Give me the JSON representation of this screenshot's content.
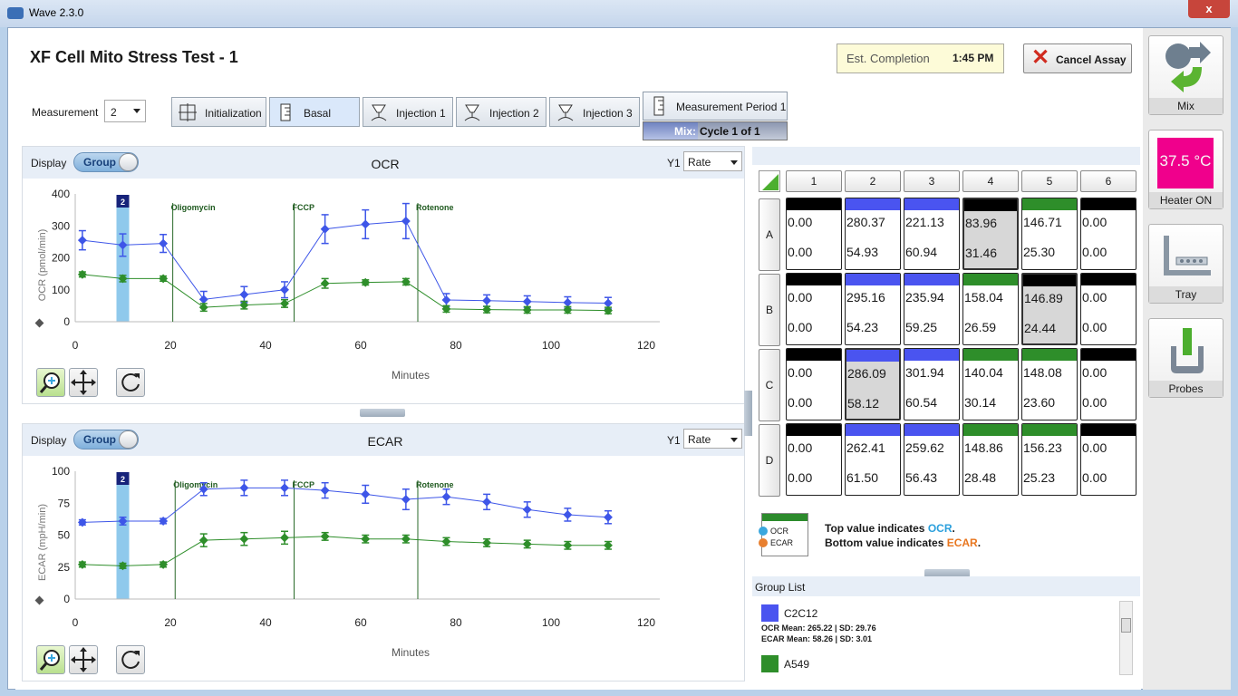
{
  "window": {
    "title": "Wave 2.3.0",
    "close_label": "x"
  },
  "header": {
    "title": "XF Cell Mito Stress Test - 1",
    "est_label": "Est. Completion",
    "est_value": "1:45 PM",
    "cancel_label": "Cancel Assay"
  },
  "measurement": {
    "label": "Measurement",
    "value": "2"
  },
  "steps": [
    "Initialization",
    "Basal",
    "Injection 1",
    "Injection 2",
    "Injection 3"
  ],
  "period": {
    "label": "Measurement Period 1",
    "mix_label": "Mix:",
    "cycle_label": "Cycle 1 of 1"
  },
  "display_label": "Display",
  "toggle_label": "Group",
  "y1_label": "Y1",
  "y1_value": "Rate",
  "ocr": {
    "title": "OCR",
    "ylabel": "OCR (pmol/min)",
    "xlabel": "Minutes"
  },
  "ecar": {
    "title": "ECAR",
    "ylabel": "ECAR (mpH/min)",
    "xlabel": "Minutes"
  },
  "plate": {
    "cols": [
      "1",
      "2",
      "3",
      "4",
      "5",
      "6"
    ],
    "rows": [
      "A",
      "B",
      "C",
      "D"
    ],
    "wells": [
      [
        {
          "o": "0.00",
          "e": "0.00",
          "c": "#000000"
        },
        {
          "o": "280.37",
          "e": "54.93",
          "c": "#4a54f0"
        },
        {
          "o": "221.13",
          "e": "60.94",
          "c": "#4a54f0"
        },
        {
          "o": "83.96",
          "e": "31.46",
          "c": "#000000",
          "s": 1
        },
        {
          "o": "146.71",
          "e": "25.30",
          "c": "#2e8e2a"
        },
        {
          "o": "0.00",
          "e": "0.00",
          "c": "#000000"
        }
      ],
      [
        {
          "o": "0.00",
          "e": "0.00",
          "c": "#000000"
        },
        {
          "o": "295.16",
          "e": "54.23",
          "c": "#4a54f0"
        },
        {
          "o": "235.94",
          "e": "59.25",
          "c": "#4a54f0"
        },
        {
          "o": "158.04",
          "e": "26.59",
          "c": "#2e8e2a"
        },
        {
          "o": "146.89",
          "e": "24.44",
          "c": "#000000",
          "s": 1
        },
        {
          "o": "0.00",
          "e": "0.00",
          "c": "#000000"
        }
      ],
      [
        {
          "o": "0.00",
          "e": "0.00",
          "c": "#000000"
        },
        {
          "o": "286.09",
          "e": "58.12",
          "c": "#4a54f0",
          "s": 1
        },
        {
          "o": "301.94",
          "e": "60.54",
          "c": "#4a54f0"
        },
        {
          "o": "140.04",
          "e": "30.14",
          "c": "#2e8e2a"
        },
        {
          "o": "148.08",
          "e": "23.60",
          "c": "#2e8e2a"
        },
        {
          "o": "0.00",
          "e": "0.00",
          "c": "#000000"
        }
      ],
      [
        {
          "o": "0.00",
          "e": "0.00",
          "c": "#000000"
        },
        {
          "o": "262.41",
          "e": "61.50",
          "c": "#4a54f0"
        },
        {
          "o": "259.62",
          "e": "56.43",
          "c": "#4a54f0"
        },
        {
          "o": "148.86",
          "e": "28.48",
          "c": "#2e8e2a"
        },
        {
          "o": "156.23",
          "e": "25.23",
          "c": "#2e8e2a"
        },
        {
          "o": "0.00",
          "e": "0.00",
          "c": "#000000"
        }
      ]
    ]
  },
  "legend": {
    "ocr_abbr": "OCR",
    "ecar_abbr": "ECAR",
    "line1_pre": "Top value indicates ",
    "line1_key": "OCR",
    "line2_pre": "Bottom value indicates ",
    "line2_key": "ECAR",
    "dot1": "1",
    "dot2": "2"
  },
  "group_list": {
    "title": "Group List",
    "groups": [
      {
        "name": "C2C12",
        "color": "#4a54f0",
        "ocr_stat": "OCR  Mean: 265.22 | SD: 29.76",
        "ecar_stat": "ECAR  Mean: 58.26 | SD: 3.01"
      },
      {
        "name": "A549",
        "color": "#2e8e2a"
      }
    ]
  },
  "sidebar": {
    "mix": "Mix",
    "heater_temp": "37.5 °C",
    "heater": "Heater ON",
    "tray": "Tray",
    "probes": "Probes"
  },
  "chart_data": [
    {
      "type": "line",
      "title": "OCR",
      "xlabel": "Minutes",
      "ylabel": "OCR (pmol/min)",
      "xlim": [
        0,
        120
      ],
      "ylim": [
        0,
        400
      ],
      "xticks": [
        0,
        20,
        40,
        60,
        80,
        100,
        120
      ],
      "yticks": [
        0,
        100,
        200,
        300,
        400
      ],
      "highlight": {
        "x": 10,
        "label": "2"
      },
      "injections": [
        {
          "x": 20.5,
          "label": "Oligomycin"
        },
        {
          "x": 46,
          "label": "FCCP"
        },
        {
          "x": 72,
          "label": "Rotenone"
        }
      ],
      "series": [
        {
          "color": "#3e56e8",
          "x": [
            1.5,
            10,
            18.5,
            27,
            35.5,
            44,
            52.5,
            61,
            69.5,
            78,
            86.5,
            95,
            103.5,
            112
          ],
          "y": [
            255,
            240,
            245,
            70,
            85,
            100,
            290,
            305,
            315,
            68,
            66,
            63,
            60,
            58
          ],
          "err": [
            30,
            35,
            28,
            25,
            25,
            25,
            45,
            45,
            55,
            20,
            18,
            18,
            18,
            18
          ]
        },
        {
          "color": "#2e8e2a",
          "x": [
            1.5,
            10,
            18.5,
            27,
            35.5,
            44,
            52.5,
            61,
            69.5,
            78,
            86.5,
            95,
            103.5,
            112
          ],
          "y": [
            148,
            135,
            135,
            45,
            52,
            57,
            120,
            123,
            125,
            40,
            38,
            37,
            37,
            35
          ],
          "err": [
            8,
            10,
            8,
            12,
            12,
            12,
            15,
            8,
            10,
            10,
            10,
            10,
            10,
            10
          ]
        }
      ]
    },
    {
      "type": "line",
      "title": "ECAR",
      "xlabel": "Minutes",
      "ylabel": "ECAR (mpH/min)",
      "xlim": [
        0,
        120
      ],
      "ylim": [
        0,
        100
      ],
      "xticks": [
        0,
        20,
        40,
        60,
        80,
        100,
        120
      ],
      "yticks": [
        0,
        25,
        50,
        75,
        100
      ],
      "highlight": {
        "x": 10,
        "label": "2"
      },
      "injections": [
        {
          "x": 21,
          "label": "Oligomycin"
        },
        {
          "x": 46,
          "label": "FCCP"
        },
        {
          "x": 72,
          "label": "Rotenone"
        }
      ],
      "series": [
        {
          "color": "#3e56e8",
          "x": [
            1.5,
            10,
            18.5,
            27,
            35.5,
            44,
            52.5,
            61,
            69.5,
            78,
            86.5,
            95,
            103.5,
            112
          ],
          "y": [
            60,
            61,
            61,
            86,
            87,
            87,
            85,
            82,
            78,
            80,
            76,
            70,
            66,
            64
          ],
          "err": [
            2,
            3,
            2,
            5,
            6,
            6,
            6,
            7,
            8,
            6,
            6,
            6,
            5,
            5
          ]
        },
        {
          "color": "#2e8e2a",
          "x": [
            1.5,
            10,
            18.5,
            27,
            35.5,
            44,
            52.5,
            61,
            69.5,
            78,
            86.5,
            95,
            103.5,
            112
          ],
          "y": [
            27,
            26,
            27,
            46,
            47,
            48,
            49,
            47,
            47,
            45,
            44,
            43,
            42,
            42
          ],
          "err": [
            2,
            2,
            2,
            5,
            5,
            5,
            3,
            3,
            3,
            3,
            3,
            3,
            3,
            3
          ]
        }
      ]
    }
  ]
}
